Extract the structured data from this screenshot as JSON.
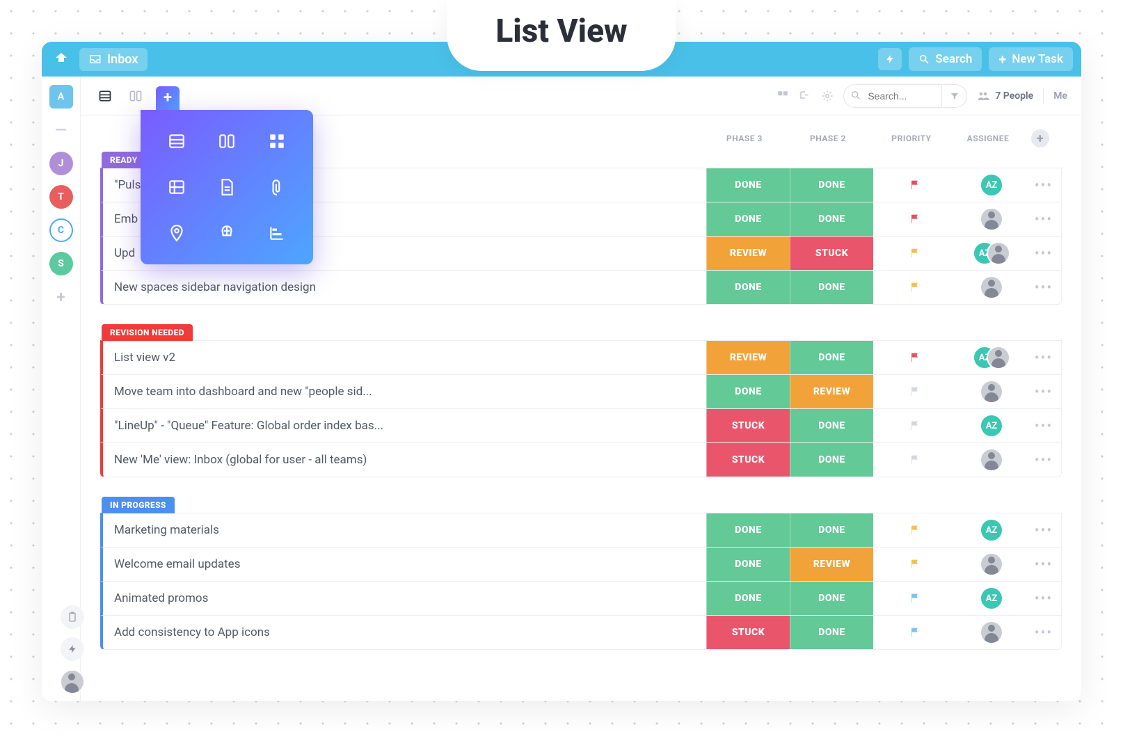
{
  "hero": {
    "title": "List View"
  },
  "topbar": {
    "inbox_label": "Inbox",
    "search_label": "Search",
    "new_task_label": "New Task"
  },
  "leftrail": {
    "items": [
      {
        "letter": "A",
        "bg": "#6ec5ec",
        "shape": "square"
      },
      {
        "letter": "—",
        "bg": "transparent",
        "shape": "dash"
      },
      {
        "letter": "J",
        "bg": "#b08fd8",
        "shape": "circle"
      },
      {
        "letter": "T",
        "bg": "#e85d5d",
        "shape": "circle"
      },
      {
        "letter": "C",
        "bg": "#ffffff",
        "shape": "ring",
        "ring": "#4da6ff"
      },
      {
        "letter": "S",
        "bg": "#5dc9a0",
        "shape": "circle"
      },
      {
        "letter": "+",
        "bg": "transparent",
        "shape": "plus"
      }
    ]
  },
  "toolbar": {
    "search_placeholder": "Search...",
    "people_count_label": "7 People",
    "me_label": "Me"
  },
  "columns": {
    "phase3": "PHASE 3",
    "phase2": "PHASE 2",
    "priority": "PRIORITY",
    "assignee": "ASSIGNEE"
  },
  "status_colors": {
    "DONE": "#63c996",
    "REVIEW": "#f1a33a",
    "STUCK": "#e9566c"
  },
  "priority_colors": {
    "red": "#ed4b58",
    "yellow": "#f4c04e",
    "blue": "#7fc4ea",
    "grey": "#d4d7de"
  },
  "assignee_types": {
    "AZ": {
      "kind": "initials",
      "text": "AZ",
      "bg": "#3bc7b2"
    },
    "p1": {
      "kind": "photo"
    },
    "p2": {
      "kind": "photo"
    }
  },
  "groups": [
    {
      "label": "READY",
      "color": "#8f6bdc",
      "tasks": [
        {
          "title": "\"Puls",
          "phase3": "DONE",
          "phase2": "DONE",
          "priority": "red",
          "assignees": [
            "AZ"
          ]
        },
        {
          "title": "Emb",
          "phase3": "DONE",
          "phase2": "DONE",
          "priority": "red",
          "assignees": [
            "p1"
          ]
        },
        {
          "title": "Upd",
          "phase3": "REVIEW",
          "phase2": "STUCK",
          "priority": "yellow",
          "assignees": [
            "AZ",
            "p2"
          ]
        },
        {
          "title": "New spaces sidebar navigation design",
          "phase3": "DONE",
          "phase2": "DONE",
          "priority": "yellow",
          "assignees": [
            "p2"
          ]
        }
      ]
    },
    {
      "label": "REVISION NEEDED",
      "color": "#ef3b3b",
      "tasks": [
        {
          "title": "List view v2",
          "phase3": "REVIEW",
          "phase2": "DONE",
          "priority": "red",
          "assignees": [
            "AZ",
            "p1"
          ]
        },
        {
          "title": "Move team into dashboard and new \"people sid...",
          "phase3": "DONE",
          "phase2": "REVIEW",
          "priority": "grey",
          "assignees": [
            "p1"
          ]
        },
        {
          "title": "\"LineUp\" - \"Queue\" Feature: Global order index bas...",
          "phase3": "STUCK",
          "phase2": "DONE",
          "priority": "grey",
          "assignees": [
            "AZ"
          ]
        },
        {
          "title": "New 'Me' view: Inbox (global for user - all teams)",
          "phase3": "STUCK",
          "phase2": "DONE",
          "priority": "grey",
          "assignees": [
            "p2"
          ]
        }
      ]
    },
    {
      "label": "IN PROGRESS",
      "color": "#4b8ff0",
      "tasks": [
        {
          "title": "Marketing  materials",
          "phase3": "DONE",
          "phase2": "DONE",
          "priority": "yellow",
          "assignees": [
            "AZ"
          ]
        },
        {
          "title": "Welcome email updates",
          "phase3": "DONE",
          "phase2": "REVIEW",
          "priority": "yellow",
          "assignees": [
            "p1"
          ]
        },
        {
          "title": "Animated promos",
          "phase3": "DONE",
          "phase2": "DONE",
          "priority": "blue",
          "assignees": [
            "AZ"
          ]
        },
        {
          "title": "Add consistency to App icons",
          "phase3": "STUCK",
          "phase2": "DONE",
          "priority": "blue",
          "assignees": [
            "p2"
          ]
        }
      ]
    }
  ],
  "popover_views": [
    "list-view-icon",
    "board-view-icon",
    "box-view-icon",
    "table-view-icon",
    "doc-view-icon",
    "attach-view-icon",
    "map-view-icon",
    "mind-view-icon",
    "gantt-view-icon"
  ]
}
